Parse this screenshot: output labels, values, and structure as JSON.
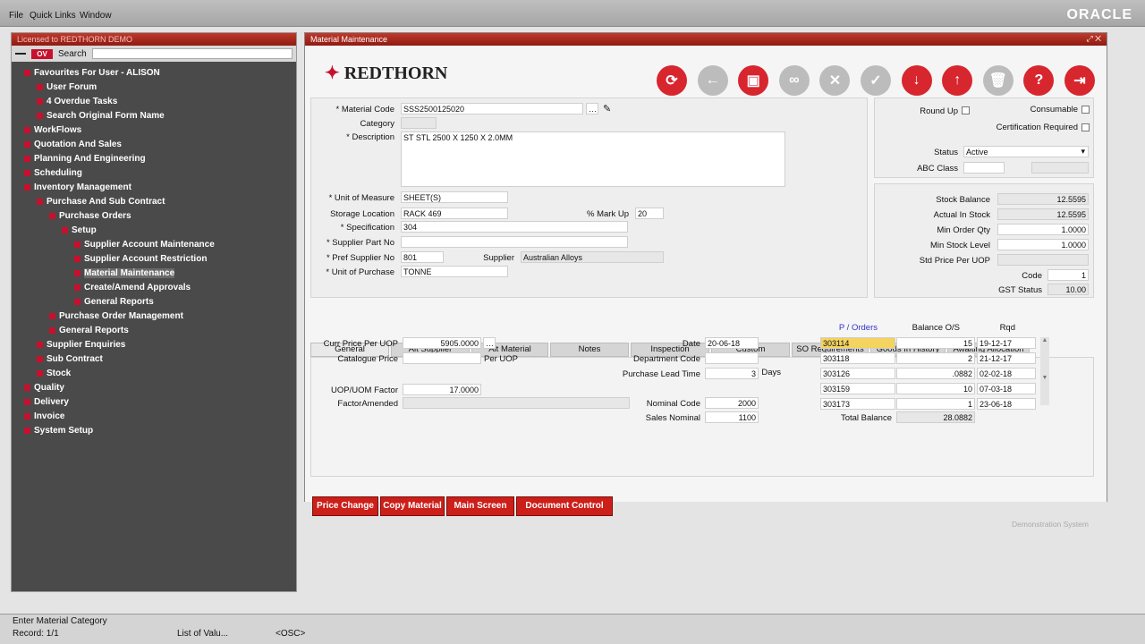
{
  "menu": {
    "file": "File",
    "quick_links": "Quick Links",
    "window": "Window",
    "brand": "ORACLE"
  },
  "nav": {
    "title": "Licensed to REDTHORN DEMO",
    "search_label": "Search",
    "ov_badge": "OV",
    "tree": [
      {
        "label": "Favourites For User - ALISON",
        "icon": "star-icon"
      },
      {
        "label": "User Forum",
        "icon": "users-icon"
      },
      {
        "label": "4 Overdue Tasks",
        "icon": "task-icon"
      },
      {
        "label": "Search Original Form Name",
        "icon": "search-icon"
      },
      {
        "label": "WorkFlows",
        "icon": "folder-icon"
      },
      {
        "label": "Quotation And Sales",
        "icon": "folder-icon"
      },
      {
        "label": "Planning And Engineering",
        "icon": "folder-icon"
      },
      {
        "label": "Scheduling",
        "icon": "folder-icon"
      },
      {
        "label": "Inventory Management",
        "icon": "folder-icon"
      },
      {
        "label": "Purchase And Sub Contract",
        "icon": "folder-icon"
      },
      {
        "label": "Purchase Orders",
        "icon": "folder-icon"
      },
      {
        "label": "Setup",
        "icon": "folder-icon"
      },
      {
        "label": "Supplier Account Maintenance",
        "icon": "form-icon"
      },
      {
        "label": "Supplier Account Restriction",
        "icon": "form-icon"
      },
      {
        "label": "Material Maintenance",
        "icon": "form-icon"
      },
      {
        "label": "Create/Amend Approvals",
        "icon": "form-icon"
      },
      {
        "label": "General Reports",
        "icon": "form-icon"
      },
      {
        "label": "Purchase Order Management",
        "icon": "folder-icon"
      },
      {
        "label": "General Reports",
        "icon": "folder-icon"
      },
      {
        "label": "Supplier Enquiries",
        "icon": "folder-icon"
      },
      {
        "label": "Sub Contract",
        "icon": "folder-icon"
      },
      {
        "label": "Stock",
        "icon": "folder-icon"
      },
      {
        "label": "Quality",
        "icon": "folder-icon"
      },
      {
        "label": "Delivery",
        "icon": "folder-icon"
      },
      {
        "label": "Invoice",
        "icon": "folder-icon"
      },
      {
        "label": "System Setup",
        "icon": "folder-icon"
      }
    ]
  },
  "window": {
    "title": "Material Maintenance",
    "logo": "REDTHORN",
    "footer": "Demonstration System"
  },
  "toolbar": [
    "refresh-icon",
    "back-icon",
    "save-icon",
    "find-icon",
    "cancel-icon",
    "confirm-icon",
    "down-icon",
    "up-icon",
    "delete-icon",
    "help-icon",
    "exit-icon"
  ],
  "header": {
    "material_code_label": "* Material Code",
    "material_code": "SSS2500125020",
    "category_label": "Category",
    "category": "",
    "description_label": "* Description",
    "description": "ST STL 2500 X 1250 X 2.0MM",
    "uom_label": "* Unit of Measure",
    "uom": "SHEET(S)",
    "storage_label": "Storage Location",
    "storage": "RACK 469",
    "markup_label": "% Mark Up",
    "markup": "20",
    "spec_label": "* Specification",
    "spec": "304",
    "supplier_part_label": "* Supplier Part No",
    "supplier_part": "",
    "pref_supplier_label": "* Pref Supplier No",
    "pref_supplier": "801",
    "supplier_label": "Supplier",
    "supplier": "Australian Alloys",
    "uop_label": "* Unit of Purchase",
    "uop": "TONNE"
  },
  "right": {
    "round_up": "Round Up",
    "consumable": "Consumable",
    "cert": "Certification Required",
    "status_label": "Status",
    "status": "Active",
    "abc_label": "ABC Class",
    "abc": "",
    "stock_balance_label": "Stock Balance",
    "stock_balance": "12.5595",
    "actual_label": "Actual In Stock",
    "actual": "12.5595",
    "min_order_label": "Min Order Qty",
    "min_order": "1.0000",
    "min_stock_label": "Min Stock Level",
    "min_stock": "1.0000",
    "std_price_label": "Std Price Per UOP",
    "std_price": "",
    "code_label": "Code",
    "code": "1",
    "gst_label": "GST Status",
    "gst": "10.00"
  },
  "tabs": [
    "General",
    "Alt Supplier",
    "Alt Material",
    "Notes",
    "Inspection",
    "Custom",
    "SO Requirements",
    "Goods In History",
    "Awaiting Allocation"
  ],
  "general": {
    "curr_price_label": "Curr Price Per UOP",
    "curr_price": "5905.0000",
    "catalogue_label": "Catalogue Price",
    "catalogue": "",
    "per_uop": "Per UOP",
    "factor_label": "UOP/UOM Factor",
    "factor": "17.0000",
    "factor_amended_label": "FactorAmended",
    "factor_amended": "",
    "date_label": "Date",
    "date": "20-06-18",
    "dept_label": "Department Code",
    "dept": "",
    "lead_label": "Purchase Lead Time",
    "lead": "3",
    "days": "Days",
    "nominal_label": "Nominal Code",
    "nominal": "2000",
    "sales_nominal_label": "Sales Nominal",
    "sales_nominal": "1100"
  },
  "orders": {
    "col_po": "P / Orders",
    "col_bal": "Balance O/S",
    "col_rqd": "Rqd",
    "rows": [
      {
        "po": "303114",
        "bal": "15",
        "rqd": "19-12-17"
      },
      {
        "po": "303118",
        "bal": "2",
        "rqd": "21-12-17"
      },
      {
        "po": "303126",
        "bal": ".0882",
        "rqd": "02-02-18"
      },
      {
        "po": "303159",
        "bal": "10",
        "rqd": "07-03-18"
      },
      {
        "po": "303173",
        "bal": "1",
        "rqd": "23-06-18"
      }
    ],
    "total_label": "Total Balance",
    "total": "28.0882"
  },
  "buttons": {
    "price_change": "Price Change",
    "copy_material": "Copy Material",
    "main_screen": "Main Screen",
    "document_control": "Document Control"
  },
  "status": {
    "hint": "Enter Material Category",
    "record": "Record: 1/1",
    "lov": "List of Valu...",
    "osc": "<OSC>"
  }
}
